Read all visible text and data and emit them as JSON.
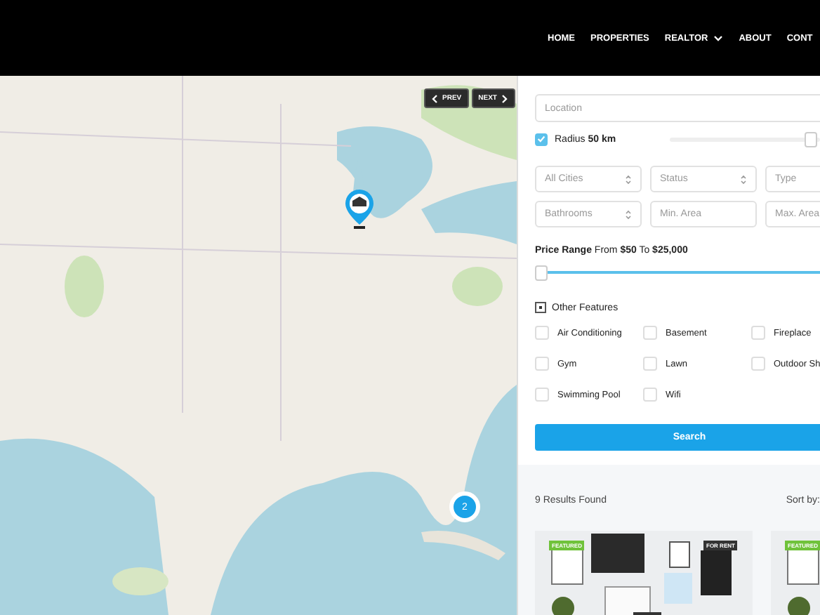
{
  "nav": {
    "items": [
      {
        "label": "HOME",
        "dropdown": false
      },
      {
        "label": "PROPERTIES",
        "dropdown": false
      },
      {
        "label": "REALTOR",
        "dropdown": true
      },
      {
        "label": "ABOUT",
        "dropdown": false
      },
      {
        "label": "CONT",
        "dropdown": false
      }
    ]
  },
  "map": {
    "kind": "picture",
    "prev": "PREV",
    "next": "NEXT",
    "cluster": "2"
  },
  "filters": {
    "location": {
      "placeholder": "Location"
    },
    "radius": {
      "label": "Radius **50 km**",
      "checked": true,
      "level": 0.93
    },
    "selects": [
      {
        "kind": "select",
        "placeholder": "All Cities"
      },
      {
        "kind": "select",
        "placeholder": "Status"
      },
      {
        "kind": "select",
        "placeholder": "Type"
      },
      {
        "kind": "select",
        "placeholder": "Bathrooms"
      },
      {
        "kind": "input",
        "placeholder": "Min. Area"
      },
      {
        "kind": "input",
        "placeholder": "Max. Area"
      }
    ],
    "price": {
      "label": "**Price Range** From **$50** To **$25,000**",
      "level": 0
    },
    "other_features": {
      "label": "Other Features",
      "expanded": true
    },
    "features": [
      {
        "label": "Air Conditioning",
        "checked": false
      },
      {
        "label": "Basement",
        "checked": false
      },
      {
        "label": "Fireplace",
        "checked": false
      },
      {
        "label": "Gym",
        "checked": false
      },
      {
        "label": "Lawn",
        "checked": false
      },
      {
        "label": "Outdoor Sh",
        "checked": false
      },
      {
        "label": "Swimming Pool",
        "checked": false
      },
      {
        "label": "Wifi",
        "checked": false
      }
    ],
    "search_button": "Search"
  },
  "results": {
    "count": "9 Results Found",
    "sort": "Sort by:",
    "cards": [
      {
        "kind": "picture",
        "badges": [
          "FEATURED",
          "FOR RENT"
        ]
      },
      {
        "kind": "picture",
        "badges": [
          "FEATURED"
        ]
      }
    ]
  }
}
